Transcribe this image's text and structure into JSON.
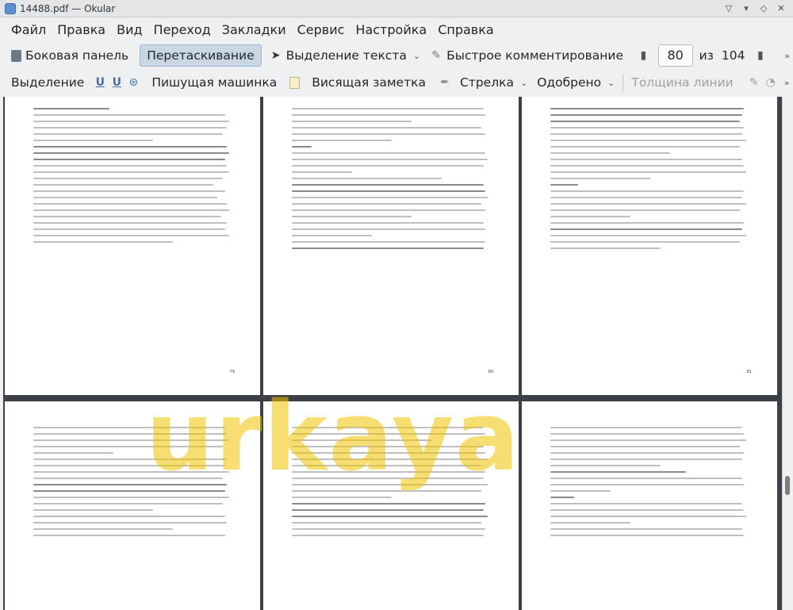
{
  "window": {
    "title": "14488.pdf — Okular"
  },
  "menubar": {
    "items": [
      "Файл",
      "Правка",
      "Вид",
      "Переход",
      "Закладки",
      "Сервис",
      "Настройка",
      "Справка"
    ]
  },
  "toolbar1": {
    "sidebar_label": "Боковая панель",
    "browse_label": "Перетаскивание",
    "text_select_label": "Выделение текста",
    "quick_annot_label": "Быстрое комментирование",
    "page_current": "80",
    "page_of": "из",
    "page_total": "104"
  },
  "toolbar2": {
    "highlight_label": "Выделение",
    "typewriter_label": "Пишущая машинка",
    "popup_note_label": "Висящая заметка",
    "arrow_label": "Стрелка",
    "approved_label": "Одобрено",
    "line_width_label": "Толщина линии"
  },
  "pages": {
    "top_left_num": "79",
    "top_mid_num": "80",
    "top_right_num": "81"
  },
  "watermark": {
    "text": "urkaya"
  }
}
